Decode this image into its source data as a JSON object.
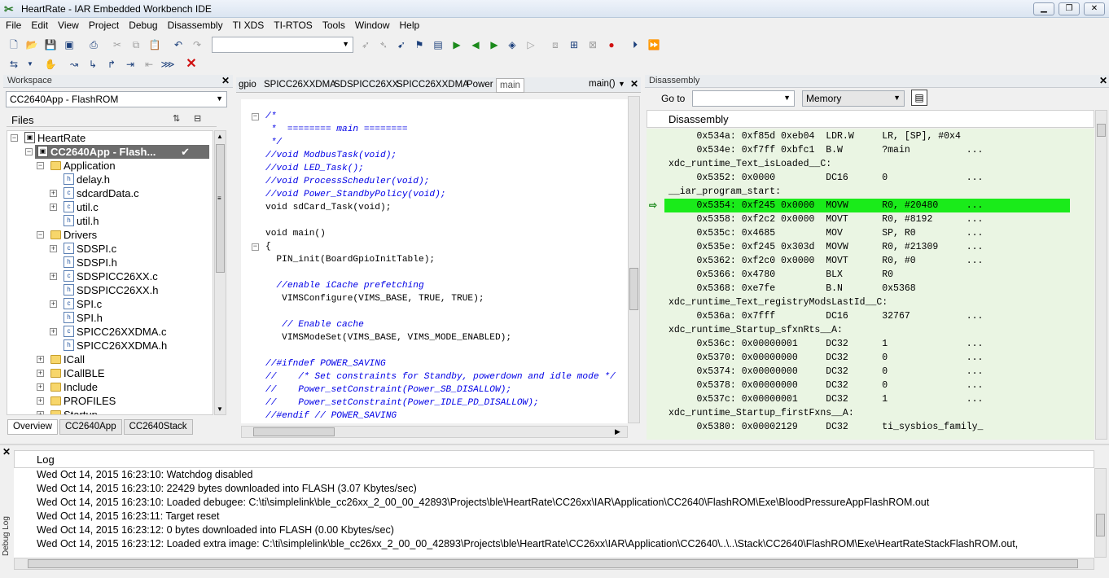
{
  "window": {
    "title": "HeartRate - IAR Embedded Workbench IDE",
    "min": "▁",
    "max": "❐",
    "close": "✕"
  },
  "menu": [
    "File",
    "Edit",
    "View",
    "Project",
    "Debug",
    "Disassembly",
    "TI XDS",
    "TI-RTOS",
    "Tools",
    "Window",
    "Help"
  ],
  "workspace": {
    "title": "Workspace",
    "config": "CC2640App - FlashROM",
    "files_header": "Files",
    "tree": [
      {
        "label": "HeartRate",
        "depth": 0,
        "exp": "−",
        "icon": "project"
      },
      {
        "label": "CC2640App - Flash...",
        "depth": 1,
        "exp": "−",
        "icon": "project",
        "selected": true,
        "check": "✔"
      },
      {
        "label": "Application",
        "depth": 2,
        "exp": "−",
        "icon": "folder"
      },
      {
        "label": "delay.h",
        "depth": 3,
        "exp": "",
        "icon": "h"
      },
      {
        "label": "sdcardData.c",
        "depth": 3,
        "exp": "+",
        "icon": "c"
      },
      {
        "label": "util.c",
        "depth": 3,
        "exp": "+",
        "icon": "c"
      },
      {
        "label": "util.h",
        "depth": 3,
        "exp": "",
        "icon": "h"
      },
      {
        "label": "Drivers",
        "depth": 2,
        "exp": "−",
        "icon": "folder"
      },
      {
        "label": "SDSPI.c",
        "depth": 3,
        "exp": "+",
        "icon": "c"
      },
      {
        "label": "SDSPI.h",
        "depth": 3,
        "exp": "",
        "icon": "h"
      },
      {
        "label": "SDSPICC26XX.c",
        "depth": 3,
        "exp": "+",
        "icon": "c"
      },
      {
        "label": "SDSPICC26XX.h",
        "depth": 3,
        "exp": "",
        "icon": "h"
      },
      {
        "label": "SPI.c",
        "depth": 3,
        "exp": "+",
        "icon": "c"
      },
      {
        "label": "SPI.h",
        "depth": 3,
        "exp": "",
        "icon": "h"
      },
      {
        "label": "SPICC26XXDMA.c",
        "depth": 3,
        "exp": "+",
        "icon": "c"
      },
      {
        "label": "SPICC26XXDMA.h",
        "depth": 3,
        "exp": "",
        "icon": "h"
      },
      {
        "label": "ICall",
        "depth": 2,
        "exp": "+",
        "icon": "folder"
      },
      {
        "label": "ICallBLE",
        "depth": 2,
        "exp": "+",
        "icon": "folder"
      },
      {
        "label": "Include",
        "depth": 2,
        "exp": "+",
        "icon": "folder"
      },
      {
        "label": "PROFILES",
        "depth": 2,
        "exp": "+",
        "icon": "folder"
      },
      {
        "label": "Startup",
        "depth": 2,
        "exp": "+",
        "icon": "folder"
      }
    ],
    "tabs": [
      "Overview",
      "CC2640App",
      "CC2640Stack"
    ]
  },
  "editor": {
    "tabs": [
      "gpio",
      "SPICC26XXDMA",
      "SDSPICC26XX",
      "SPICC26XXDMA",
      "Power",
      "main"
    ],
    "func": "main()",
    "lines": [
      {
        "t": "/*",
        "c": true
      },
      {
        "t": " *  ======== main ========",
        "c": true
      },
      {
        "t": " */",
        "c": true
      },
      {
        "t": "//void ModbusTask(void);",
        "c": true
      },
      {
        "t": "//void LED_Task();",
        "c": true
      },
      {
        "t": "//void ProcessScheduler(void);",
        "c": true
      },
      {
        "t": "//void Power_StandbyPolicy(void);",
        "c": true
      },
      {
        "t": "void sdCard_Task(void);",
        "c": false
      },
      {
        "t": "",
        "c": false
      },
      {
        "t": "void main()",
        "c": false
      },
      {
        "t": "{",
        "c": false
      },
      {
        "t": "  PIN_init(BoardGpioInitTable);",
        "c": false
      },
      {
        "t": "",
        "c": false
      },
      {
        "t": "  //enable iCache prefetching",
        "c": true
      },
      {
        "t": "   VIMSConfigure(VIMS_BASE, TRUE, TRUE);",
        "c": false
      },
      {
        "t": "",
        "c": false
      },
      {
        "t": "   // Enable cache",
        "c": true
      },
      {
        "t": "   VIMSModeSet(VIMS_BASE, VIMS_MODE_ENABLED);",
        "c": false
      },
      {
        "t": "",
        "c": false
      },
      {
        "t": "//#ifndef POWER_SAVING",
        "c": true
      },
      {
        "t": "//    /* Set constraints for Standby, powerdown and idle mode */",
        "c": true
      },
      {
        "t": "//    Power_setConstraint(Power_SB_DISALLOW);",
        "c": true
      },
      {
        "t": "//    Power_setConstraint(Power_IDLE_PD_DISALLOW);",
        "c": true
      },
      {
        "t": "//#endif // POWER_SAVING",
        "c": true
      }
    ]
  },
  "disassembly": {
    "title": "Disassembly",
    "goto_label": "Go to",
    "mem": "Memory",
    "header": "Disassembly",
    "lines": [
      "     0x534a: 0xf85d 0xeb04  LDR.W     LR, [SP], #0x4",
      "     0x534e: 0xf7ff 0xbfc1  B.W       ?main          ...",
      "xdc_runtime_Text_isLoaded__C:",
      "     0x5352: 0x0000         DC16      0              ...",
      "__iar_program_start:",
      "     0x5354: 0xf245 0x0000  MOVW      R0, #20480     ...",
      "     0x5358: 0xf2c2 0x0000  MOVT      R0, #8192      ...",
      "     0x535c: 0x4685         MOV       SP, R0         ...",
      "     0x535e: 0xf245 0x303d  MOVW      R0, #21309     ...",
      "     0x5362: 0xf2c0 0x0000  MOVT      R0, #0         ...",
      "     0x5366: 0x4780         BLX       R0",
      "     0x5368: 0xe7fe         B.N       0x5368",
      "xdc_runtime_Text_registryModsLastId__C:",
      "     0x536a: 0x7fff         DC16      32767          ...",
      "xdc_runtime_Startup_sfxnRts__A:",
      "     0x536c: 0x00000001     DC32      1              ...",
      "     0x5370: 0x00000000     DC32      0              ...",
      "     0x5374: 0x00000000     DC32      0              ...",
      "     0x5378: 0x00000000     DC32      0              ...",
      "     0x537c: 0x00000001     DC32      1              ...",
      "xdc_runtime_Startup_firstFxns__A:",
      "     0x5380: 0x00002129     DC32      ti_sysbios_family_"
    ],
    "highlight_index": 5
  },
  "log": {
    "header": "Log",
    "side_label": "Debug Log",
    "lines": [
      "Wed Oct 14, 2015 16:23:10: Watchdog disabled",
      "Wed Oct 14, 2015 16:23:10: 22429 bytes downloaded into FLASH (3.07 Kbytes/sec)",
      "Wed Oct 14, 2015 16:23:10: Loaded debugee: C:\\ti\\simplelink\\ble_cc26xx_2_00_00_42893\\Projects\\ble\\HeartRate\\CC26xx\\IAR\\Application\\CC2640\\FlashROM\\Exe\\BloodPressureAppFlashROM.out",
      "Wed Oct 14, 2015 16:23:11: Target reset",
      "Wed Oct 14, 2015 16:23:12: 0 bytes downloaded into FLASH (0.00 Kbytes/sec)",
      "Wed Oct 14, 2015 16:23:12: Loaded extra image: C:\\ti\\simplelink\\ble_cc26xx_2_00_00_42893\\Projects\\ble\\HeartRate\\CC26xx\\IAR\\Application\\CC2640\\..\\..\\Stack\\CC2640\\FlashROM\\Exe\\HeartRateStackFlashROM.out,"
    ]
  },
  "colors": {
    "highlight": "#1aeb1a",
    "disasm_bg": "#eaf5e3",
    "comment": "#0000e6"
  }
}
